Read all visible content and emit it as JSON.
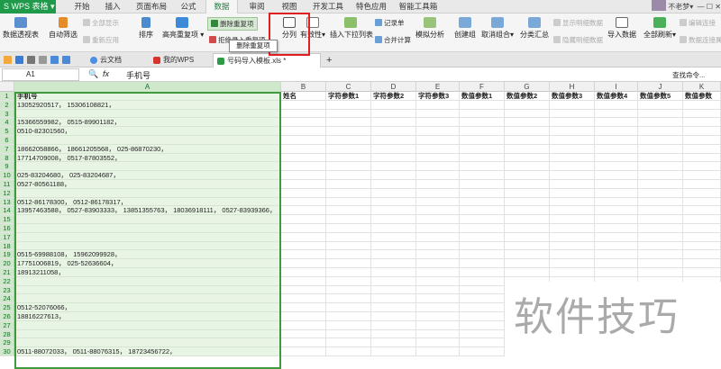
{
  "app": {
    "name": "WPS 表格"
  },
  "menu": {
    "items": [
      "开始",
      "插入",
      "页面布局",
      "公式",
      "数据",
      "审阅",
      "视图",
      "开发工具",
      "特色应用",
      "智能工具箱"
    ],
    "active": "数据"
  },
  "window": {
    "user": "不老梦",
    "controls": "— ☐ ✕"
  },
  "ribbon": {
    "pivot": "数据透视表",
    "autofilter": "自动筛选",
    "show_all": "全部显示",
    "reapply": "重新应用",
    "sort": "排序",
    "highlight_dup": "高亮重复项",
    "delete_dup": "删除重复项",
    "reject_dup": "拒绝录入重复项",
    "split_col": "分列",
    "validity": "有效性",
    "insert_dropdown": "插入下拉列表",
    "record_sheet": "记录单",
    "merge_calc": "合并计算",
    "simulation": "模拟分析",
    "create_group": "创建组",
    "ungroup": "取消组合",
    "subtotal": "分类汇总",
    "show_detail": "显示明细数据",
    "hide_detail": "隐藏明细数据",
    "import": "导入数据",
    "refresh_all": "全部刷新",
    "edit_link": "编辑连接",
    "link_props": "数据连接属性",
    "tooltip": "删除重复项"
  },
  "tabs": {
    "cloud": "云文档",
    "mywps": "我的WPS",
    "file": "号码导入模板.xls *",
    "new": "+"
  },
  "formula_bar": {
    "cell_ref": "A1",
    "fx": "fx",
    "value": "手机号",
    "search_placeholder": "查找命令..."
  },
  "columns": [
    "A",
    "B",
    "C",
    "D",
    "E",
    "F",
    "G",
    "H",
    "I",
    "J",
    "K"
  ],
  "header_row": {
    "A": "手机号",
    "B": "姓名",
    "C": "字符参数1",
    "D": "字符参数2",
    "E": "字符参数3",
    "F": "数值参数1",
    "G": "数值参数2",
    "H": "数值参数3",
    "I": "数值参数4",
    "J": "数值参数5",
    "K": "数值参数"
  },
  "rows": [
    {
      "n": "1",
      "a": "手机号"
    },
    {
      "n": "2",
      "a": "13052920517， 15306108821，"
    },
    {
      "n": "3",
      "a": ""
    },
    {
      "n": "4",
      "a": "15366559982， 0515-89901182，"
    },
    {
      "n": "5",
      "a": "0510-82301560，"
    },
    {
      "n": "6",
      "a": ""
    },
    {
      "n": "7",
      "a": "18662058866， 18661205568， 025-86870230，"
    },
    {
      "n": "8",
      "a": "17714709008， 0517-87803552，"
    },
    {
      "n": "9",
      "a": ""
    },
    {
      "n": "10",
      "a": "025-83204680， 025-83204687，"
    },
    {
      "n": "11",
      "a": "0527-80561188，"
    },
    {
      "n": "12",
      "a": ""
    },
    {
      "n": "13",
      "a": "0512-86178300， 0512-86178317，"
    },
    {
      "n": "14",
      "a": "13957463588， 0527-83903333， 13851355763， 18036918111， 0527-83939366，"
    },
    {
      "n": "15",
      "a": ""
    },
    {
      "n": "16",
      "a": ""
    },
    {
      "n": "17",
      "a": ""
    },
    {
      "n": "18",
      "a": ""
    },
    {
      "n": "19",
      "a": "0515-69988108， 15962099928，"
    },
    {
      "n": "20",
      "a": "17751006819， 025-52636604，"
    },
    {
      "n": "21",
      "a": "18913211058，"
    },
    {
      "n": "22",
      "a": ""
    },
    {
      "n": "23",
      "a": ""
    },
    {
      "n": "24",
      "a": ""
    },
    {
      "n": "25",
      "a": "0512-52076066，"
    },
    {
      "n": "26",
      "a": "18816227613，"
    },
    {
      "n": "27",
      "a": ""
    },
    {
      "n": "28",
      "a": ""
    },
    {
      "n": "29",
      "a": ""
    },
    {
      "n": "30",
      "a": "0511-88072033， 0511-88076315， 18723456722，"
    }
  ],
  "watermark": "软件技巧",
  "colors": {
    "brand": "#1e9a4a",
    "selection": "#3d9a3d",
    "highlight": "#e02020"
  }
}
